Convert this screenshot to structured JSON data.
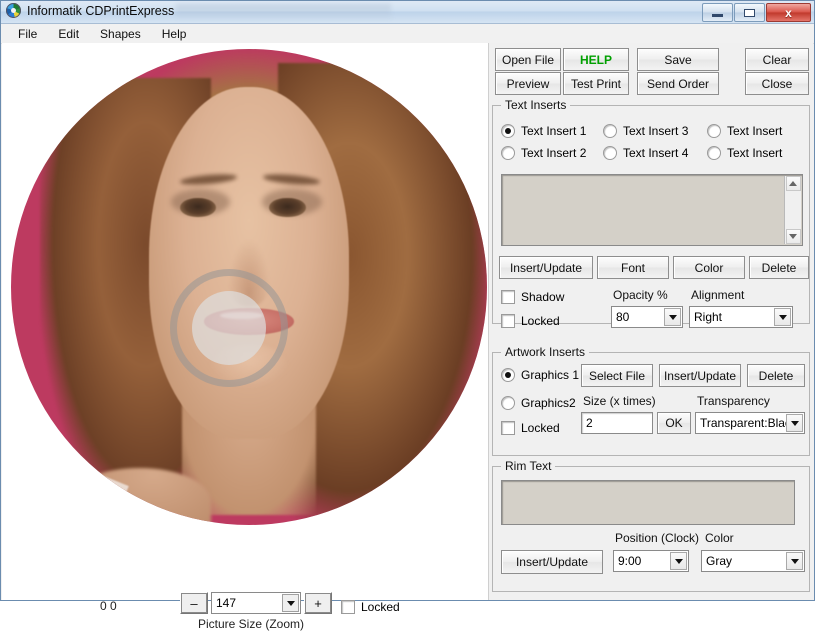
{
  "window": {
    "title": "Informatik CDPrintExpress",
    "icon": "cd-disc-icon",
    "minimize_label": "",
    "maximize_label": "",
    "close_label": "x"
  },
  "menu": {
    "items": [
      {
        "label": "File"
      },
      {
        "label": "Edit"
      },
      {
        "label": "Shapes"
      },
      {
        "label": "Help"
      }
    ]
  },
  "toolbar": {
    "open_file": "Open File",
    "help": "HELP",
    "save": "Save",
    "clear": "Clear",
    "preview": "Preview",
    "test_print": "Test Print",
    "send_order": "Send Order",
    "close": "Close",
    "help_color": "#00a000"
  },
  "text_inserts": {
    "legend": "Text Inserts",
    "radios": [
      {
        "label": "Text Insert 1",
        "selected": true
      },
      {
        "label": "Text Insert 2",
        "selected": false
      },
      {
        "label": "Text Insert 3",
        "selected": false
      },
      {
        "label": "Text Insert 4",
        "selected": false
      },
      {
        "label": "Text Insert",
        "selected": false
      },
      {
        "label": "Text Insert",
        "selected": false
      }
    ],
    "editor_value": "",
    "buttons": {
      "insert_update": "Insert/Update",
      "font": "Font",
      "color": "Color",
      "delete": "Delete"
    },
    "shadow_label": "Shadow",
    "shadow_checked": false,
    "locked_label": "Locked",
    "locked_checked": false,
    "opacity_label": "Opacity %",
    "opacity_value": "80",
    "alignment_label": "Alignment",
    "alignment_value": "Right"
  },
  "artwork_inserts": {
    "legend": "Artwork Inserts",
    "graphics1_label": "Graphics 1",
    "graphics1_selected": true,
    "graphics2_label": "Graphics2",
    "graphics2_selected": false,
    "locked_label": "Locked",
    "locked_checked": false,
    "select_file": "Select File",
    "insert_update": "Insert/Update",
    "delete": "Delete",
    "size_label": "Size (x times)",
    "size_value": "2",
    "ok": "OK",
    "transparency_label": "Transparency",
    "transparency_value": "Transparent:Blac"
  },
  "rim_text": {
    "legend": "Rim Text",
    "editor_value": "",
    "insert_update": "Insert/Update",
    "position_label": "Position (Clock)",
    "position_value": "9:00",
    "color_label": "Color",
    "color_value": "Gray"
  },
  "canvas": {
    "coords": "0 0",
    "zoom_minus": "–",
    "zoom_value": "147",
    "zoom_plus": "+",
    "zoom_label": "Picture Size (Zoom)",
    "locked_label": "Locked",
    "locked_checked": false,
    "disc_background_color": "#bd3a60",
    "artwork_description": "portrait-photograph"
  }
}
